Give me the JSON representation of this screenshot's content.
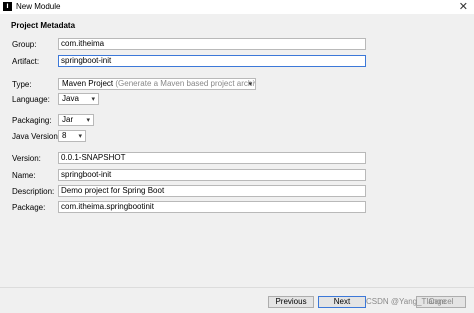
{
  "window": {
    "title": "New Module",
    "app_icon": "I",
    "close_glyph": "✕"
  },
  "section_title": "Project Metadata",
  "fields": {
    "group": {
      "label": "Group:",
      "value": "com.itheima"
    },
    "artifact": {
      "label": "Artifact:",
      "value": "springboot-init"
    },
    "type": {
      "label": "Type:",
      "value": "Maven Project",
      "hint": "(Generate a Maven based project archive)"
    },
    "language": {
      "label": "Language:",
      "value": "Java"
    },
    "packaging": {
      "label": "Packaging:",
      "value": "Jar"
    },
    "java_version": {
      "label": "Java Version:",
      "value": "8"
    },
    "version": {
      "label": "Version:",
      "value": "0.0.1-SNAPSHOT"
    },
    "name": {
      "label": "Name:",
      "value": "springboot-init"
    },
    "description": {
      "label": "Description:",
      "value": "Demo project for Spring Boot"
    },
    "package": {
      "label": "Package:",
      "value": "com.itheima.springbootinit"
    }
  },
  "buttons": {
    "previous": "Previous",
    "next": "Next",
    "cancel": "Cancel"
  },
  "watermark": "CSDN @Yang_Tlange"
}
